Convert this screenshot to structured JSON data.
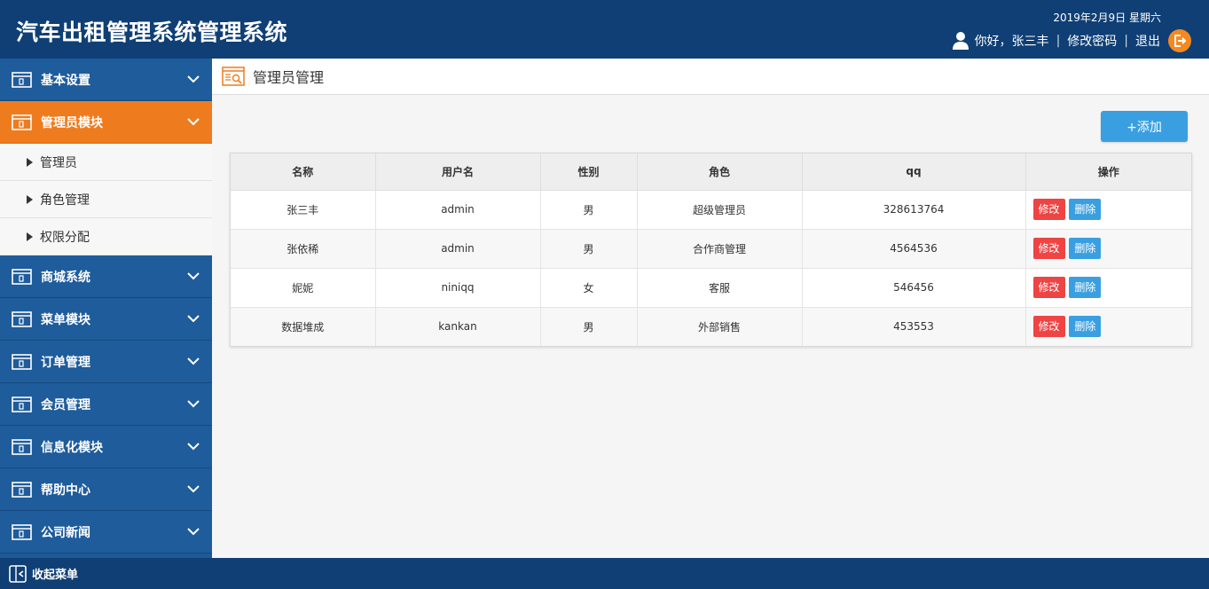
{
  "header": {
    "title": "汽车出租管理系统管理系统",
    "date": "2019年2月9日  星期六",
    "greeting": "你好，张三丰",
    "change_password": "修改密码",
    "logout": "退出",
    "divider": "|"
  },
  "sidebar": {
    "groups": [
      {
        "label": "基本设置",
        "active": false
      },
      {
        "label": "管理员模块",
        "active": true
      },
      {
        "label": "商城系统",
        "active": false
      },
      {
        "label": "菜单模块",
        "active": false
      },
      {
        "label": "订单管理",
        "active": false
      },
      {
        "label": "会员管理",
        "active": false
      },
      {
        "label": "信息化模块",
        "active": false
      },
      {
        "label": "帮助中心",
        "active": false
      },
      {
        "label": "公司新闻",
        "active": false
      }
    ],
    "sub_items": [
      "管理员",
      "角色管理",
      "权限分配"
    ]
  },
  "footer": {
    "collapse_label": "收起菜单"
  },
  "main": {
    "page_title": "管理员管理",
    "add_button": "+添加",
    "table": {
      "headers": [
        "名称",
        "用户名",
        "性别",
        "角色",
        "qq",
        "操作"
      ],
      "rows": [
        [
          "张三丰",
          "admin",
          "男",
          "超级管理员",
          "328613764"
        ],
        [
          "张依稀",
          "admin",
          "男",
          "合作商管理",
          "4564536"
        ],
        [
          "妮妮",
          "niniqq",
          "女",
          "客服",
          "546456"
        ],
        [
          "数据堆成",
          "kankan",
          "男",
          "外部销售",
          "453553"
        ]
      ],
      "edit_label": "修改",
      "delete_label": "删除"
    }
  },
  "colors": {
    "header_bg": "#0f3f75",
    "sidebar_bg": "#1d5a98",
    "active_orange": "#ee7c1f",
    "primary_blue": "#3a9fe0",
    "danger_red": "#ee4444"
  }
}
